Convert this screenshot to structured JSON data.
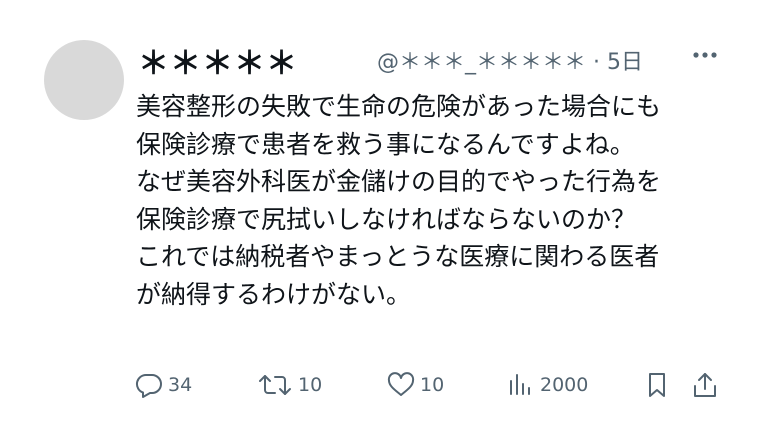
{
  "post": {
    "display_name": "＊＊＊＊＊",
    "handle": "@＊＊＊_＊＊＊＊＊",
    "separator": "·",
    "time_ago": "5日",
    "text_lines": [
      "美容整形の失敗で生命の危険があった場合にも",
      "保険診療で患者を救う事になるんですよね。",
      "なぜ美容外科医が金儲けの目的でやった行為を",
      "保険診療で尻拭いしなければならないのか？",
      "これでは納税者やまっとうな医療に関わる医者",
      "が納得するわけがない。"
    ]
  },
  "actions": {
    "replies": "34",
    "reposts": "10",
    "likes": "10",
    "views": "2000"
  },
  "icons": {
    "reply": "reply-icon",
    "repost": "repost-icon",
    "like": "heart-icon",
    "views": "views-icon",
    "bookmark": "bookmark-icon",
    "share": "share-icon",
    "more": "more-icon"
  },
  "colors": {
    "text_primary": "#0f1419",
    "text_secondary": "#536471",
    "avatar_placeholder": "#d9d9d9",
    "background": "#ffffff"
  }
}
